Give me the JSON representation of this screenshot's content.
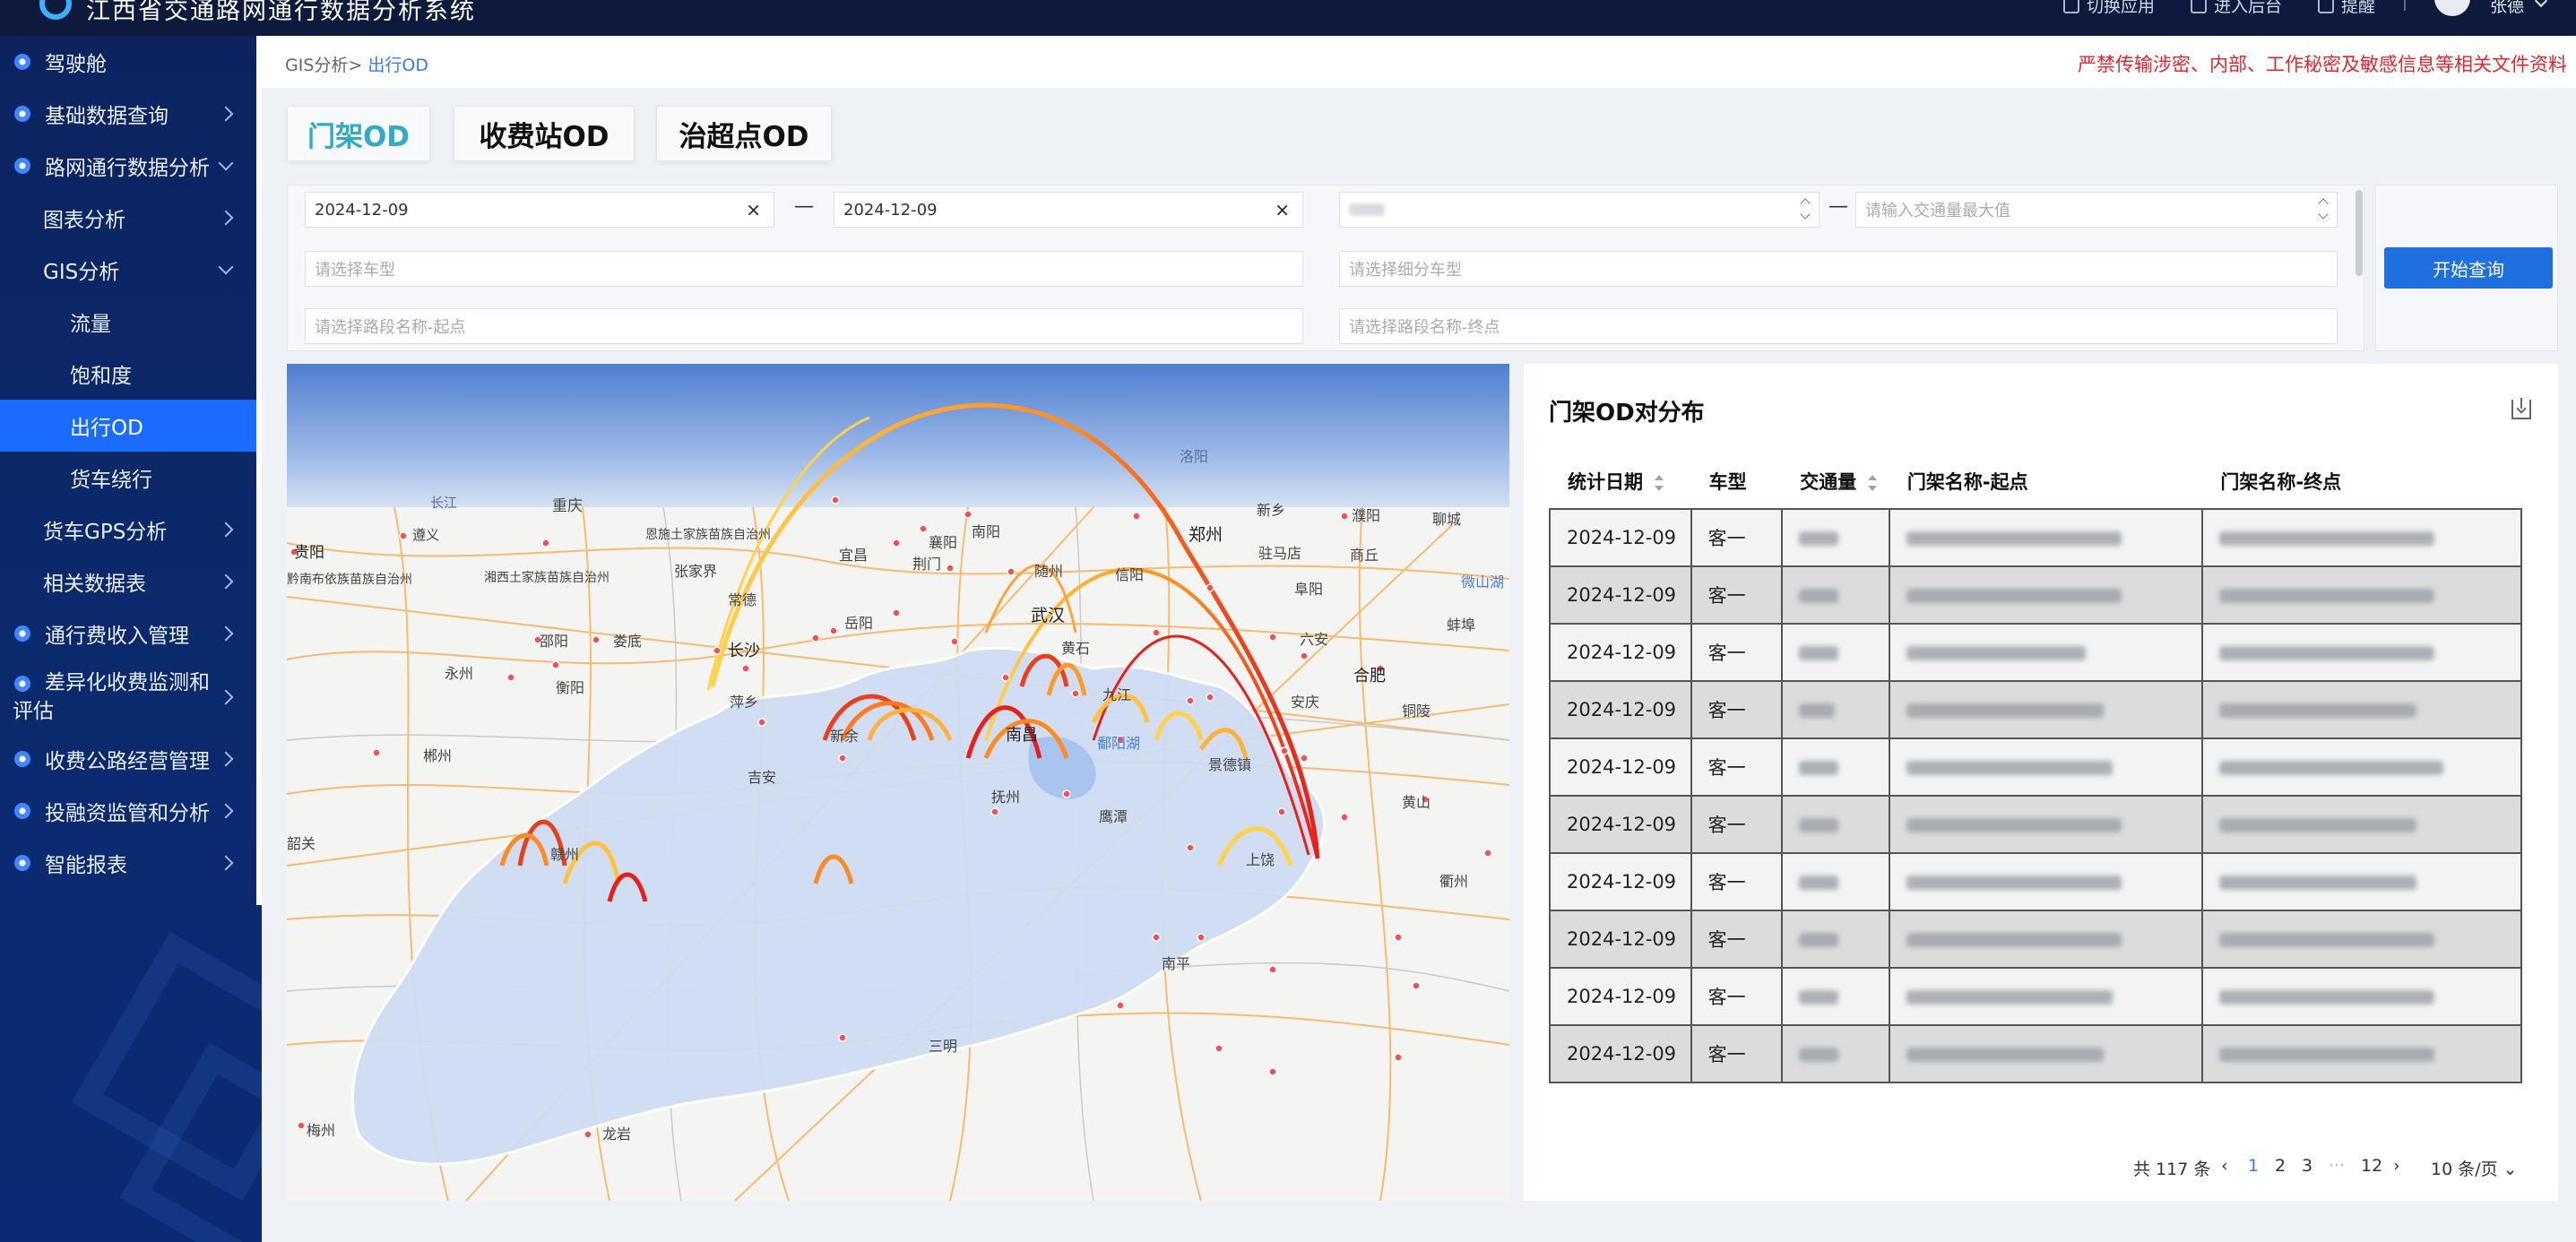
{
  "header": {
    "title": "江西省交通路网通行数据分析系统",
    "switch_app": "切换应用",
    "enter_backend": "进入后台",
    "reminder": "提醒",
    "username": "张德"
  },
  "sidebar": {
    "items": [
      {
        "label": "驾驶舱"
      },
      {
        "label": "基础数据查询"
      },
      {
        "label": "路网通行数据分析"
      },
      {
        "label": "图表分析"
      },
      {
        "label": "GIS分析"
      },
      {
        "label": "流量"
      },
      {
        "label": "饱和度"
      },
      {
        "label": "出行OD"
      },
      {
        "label": "货车绕行"
      },
      {
        "label": "货车GPS分析"
      },
      {
        "label": "相关数据表"
      },
      {
        "label": "通行费收入管理"
      },
      {
        "label": "差异化收费监测和评估"
      },
      {
        "label": "收费公路经营管理"
      },
      {
        "label": "投融资监管和分析"
      },
      {
        "label": "智能报表"
      }
    ]
  },
  "breadcrumb": {
    "parent": "GIS分析>",
    "current": "出行OD"
  },
  "warning": "严禁传输涉密、内部、工作秘密及敏感信息等相关文件资料",
  "tabs": [
    {
      "label": "门架OD"
    },
    {
      "label": "收费站OD"
    },
    {
      "label": "治超点OD"
    }
  ],
  "filters": {
    "start_date": "2024-12-09",
    "end_date": "2024-12-09",
    "range_sep": "—",
    "max_volume_placeholder": "请输入交通量最大值",
    "vehicle_type_placeholder": "请选择车型",
    "vehicle_subtype_placeholder": "请选择细分车型",
    "road_start_placeholder": "请选择路段名称-起点",
    "road_end_placeholder": "请选择路段名称-终点",
    "query_button": "开始查询"
  },
  "map": {
    "cities": [
      "贵阳",
      "遵义",
      "重庆",
      "长江",
      "恩施土家族苗族自治州",
      "宜昌",
      "襄阳",
      "南阳",
      "郑州",
      "新乡",
      "濮阳",
      "聊城",
      "湘西土家族苗族自治州",
      "张家界",
      "荆门",
      "随州",
      "信阳",
      "驻马店",
      "商丘",
      "黔南布依族苗族自治州",
      "常德",
      "岳阳",
      "武汉",
      "黄石",
      "阜阳",
      "微山湖",
      "邵阳",
      "娄底",
      "长沙",
      "六安",
      "蚌埠",
      "永州",
      "衡阳",
      "萍乡",
      "九江",
      "合肥",
      "安庆",
      "铜陵",
      "郴州",
      "新余",
      "南昌",
      "鄱阳湖",
      "景德镇",
      "吉安",
      "抚州",
      "鹰潭",
      "黄山",
      "韶关",
      "赣州",
      "上饶",
      "衢州",
      "南平",
      "三明",
      "梅州",
      "龙岩",
      "洛阳"
    ]
  },
  "od_panel": {
    "title": "门架OD对分布",
    "columns": [
      "统计日期",
      "车型",
      "交通量",
      "门架名称-起点",
      "门架名称-终点"
    ],
    "rows": [
      {
        "date": "2024-12-09",
        "type": "客一"
      },
      {
        "date": "2024-12-09",
        "type": "客一"
      },
      {
        "date": "2024-12-09",
        "type": "客一"
      },
      {
        "date": "2024-12-09",
        "type": "客一"
      },
      {
        "date": "2024-12-09",
        "type": "客一"
      },
      {
        "date": "2024-12-09",
        "type": "客一"
      },
      {
        "date": "2024-12-09",
        "type": "客一"
      },
      {
        "date": "2024-12-09",
        "type": "客一"
      },
      {
        "date": "2024-12-09",
        "type": "客一"
      },
      {
        "date": "2024-12-09",
        "type": "客一"
      }
    ],
    "pagination": {
      "total": "共 117 条",
      "pages": [
        "1",
        "2",
        "3",
        "···",
        "12"
      ],
      "current": "1",
      "page_size": "10 条/页"
    }
  }
}
